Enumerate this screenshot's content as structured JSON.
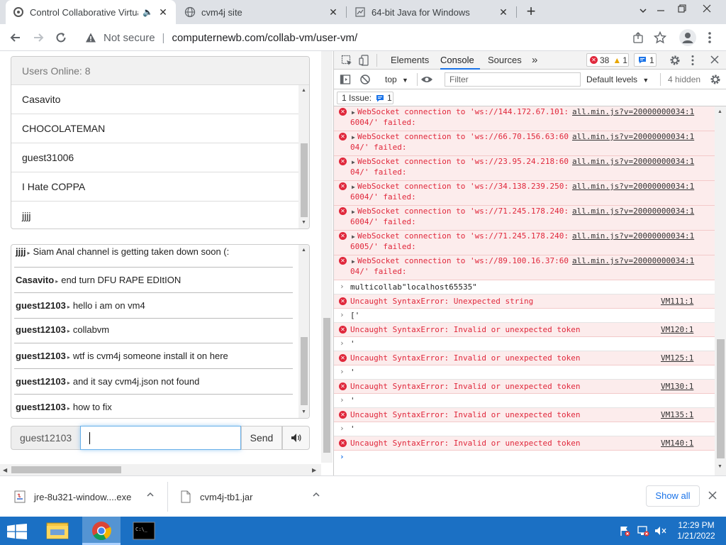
{
  "tabs": [
    {
      "title": "Control Collaborative Virtual",
      "active": true
    },
    {
      "title": "cvm4j site",
      "active": false
    },
    {
      "title": "64-bit Java for Windows",
      "active": false
    }
  ],
  "toolbar": {
    "security_label": "Not secure",
    "url": "computernewb.com/collab-vm/user-vm/"
  },
  "page": {
    "users_online": "Users Online: 8",
    "users": [
      "Casavito",
      "CHOCOLATEMAN",
      "guest31006",
      "I Hate COPPA",
      "jjjj"
    ],
    "chat": [
      {
        "user": "jjjj",
        "text": "Siam Anal channel is getting taken down soon (:"
      },
      {
        "user": "Casavito",
        "text": "end turn DFU RAPE EDItION"
      },
      {
        "user": "guest12103",
        "text": "hello i am on vm4"
      },
      {
        "user": "guest12103",
        "text": "collabvm"
      },
      {
        "user": "guest12103",
        "text": "wtf is cvm4j someone install it on here"
      },
      {
        "user": "guest12103",
        "text": "and it say cvm4j.json not found"
      },
      {
        "user": "guest12103",
        "text": "how to fix"
      }
    ],
    "username": "guest12103",
    "chat_input_value": "",
    "send_label": "Send"
  },
  "devtools": {
    "tabs": [
      "Elements",
      "Console",
      "Sources"
    ],
    "more_tabs": "»",
    "error_count": "38",
    "warning_count": "1",
    "issue_count_badge": "1",
    "context": "top",
    "filter_placeholder": "Filter",
    "levels": "Default levels",
    "hidden": "4 hidden",
    "issues_label": "1 Issue:",
    "issues_badge": "1",
    "ws_errors": [
      {
        "line1": "WebSocket connection to 'ws://144.172.67.101:",
        "src": "all.min.js?v=20000000034:1",
        "line2": "6004/' failed:"
      },
      {
        "line1": "WebSocket connection to 'ws://66.70.156.63:60",
        "src": "all.min.js?v=20000000034:1",
        "line2": "04/' failed:"
      },
      {
        "line1": "WebSocket connection to 'ws://23.95.24.218:60",
        "src": "all.min.js?v=20000000034:1",
        "line2": "04/' failed:"
      },
      {
        "line1": "WebSocket connection to 'ws://34.138.239.250:",
        "src": "all.min.js?v=20000000034:1",
        "line2": "6004/' failed:"
      },
      {
        "line1": "WebSocket connection to 'ws://71.245.178.240:",
        "src": "all.min.js?v=20000000034:1",
        "line2": "6004/' failed:"
      },
      {
        "line1": "WebSocket connection to 'ws://71.245.178.240:",
        "src": "all.min.js?v=20000000034:1",
        "line2": "6005/' failed:"
      },
      {
        "line1": "WebSocket connection to 'ws://89.100.16.37:60",
        "src": "all.min.js?v=20000000034:1",
        "line2": "04/' failed:"
      }
    ],
    "tail": [
      {
        "kind": "input",
        "text": "multicollab\"localhost65535\""
      },
      {
        "kind": "error",
        "text": "Uncaught SyntaxError: Unexpected string",
        "src": "VM111:1"
      },
      {
        "kind": "input",
        "text": "['"
      },
      {
        "kind": "error",
        "text": "Uncaught SyntaxError: Invalid or unexpected token",
        "src": "VM120:1"
      },
      {
        "kind": "input",
        "text": "'"
      },
      {
        "kind": "error",
        "text": "Uncaught SyntaxError: Invalid or unexpected token",
        "src": "VM125:1"
      },
      {
        "kind": "input",
        "text": "'"
      },
      {
        "kind": "error",
        "text": "Uncaught SyntaxError: Invalid or unexpected token",
        "src": "VM130:1"
      },
      {
        "kind": "input",
        "text": "'"
      },
      {
        "kind": "error",
        "text": "Uncaught SyntaxError: Invalid or unexpected token",
        "src": "VM135:1"
      },
      {
        "kind": "input",
        "text": "'"
      },
      {
        "kind": "error",
        "text": "Uncaught SyntaxError: Invalid or unexpected token",
        "src": "VM140:1"
      }
    ]
  },
  "downloads": {
    "items": [
      "jre-8u321-window....exe",
      "cvm4j-tb1.jar"
    ],
    "show_all": "Show all"
  },
  "taskbar": {
    "time": "12:29 PM",
    "date": "1/21/2022"
  },
  "colors": {
    "taskbar": "#1b70c4",
    "error_bg": "#fcecec",
    "error_text": "#e0273b",
    "chrome_accent": "#1a73e8"
  }
}
